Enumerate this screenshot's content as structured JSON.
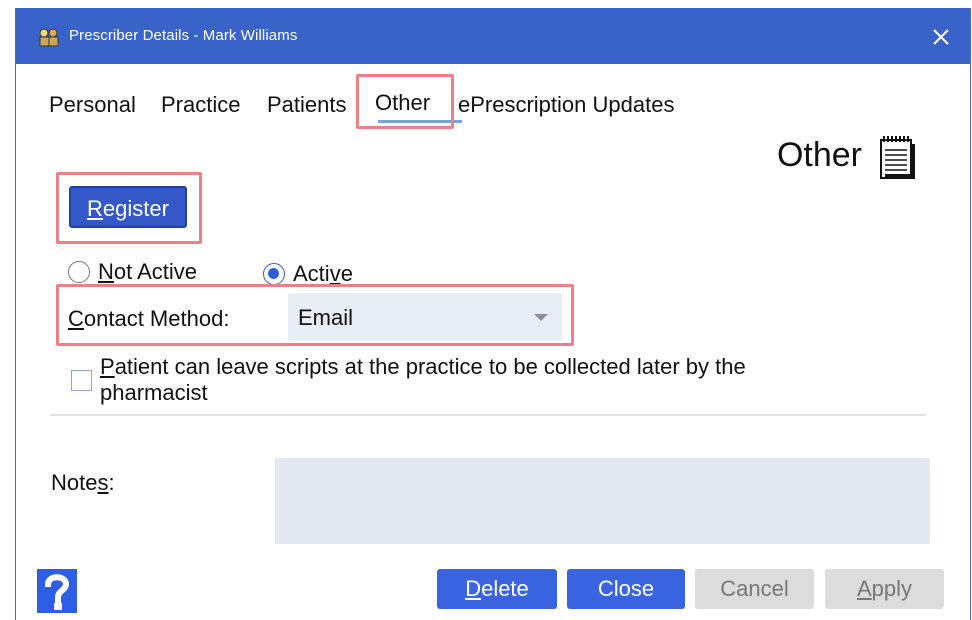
{
  "window": {
    "title": "Prescriber Details - Mark Williams"
  },
  "tabs": [
    {
      "label": "Personal"
    },
    {
      "label": "Practice"
    },
    {
      "label": "Patients"
    },
    {
      "label": "Other",
      "active": true
    },
    {
      "label": "ePrescription Updates"
    }
  ],
  "section": {
    "title": "Other",
    "icon": "notepad-icon"
  },
  "register": {
    "label_accel": "R",
    "label_rest": "egister"
  },
  "status": {
    "options": [
      {
        "accel": "N",
        "rest": "ot Active",
        "selected": false
      },
      {
        "pre": "Acti",
        "accel": "v",
        "rest": "e",
        "selected": true
      }
    ]
  },
  "contact": {
    "label_accel": "C",
    "label_rest": "ontact Method:",
    "value": "Email"
  },
  "collect": {
    "label_accel": "P",
    "label_rest": "atient can leave scripts at the practice to be collected later by the pharmacist",
    "checked": false
  },
  "notes": {
    "label_pre": "Note",
    "label_accel": "s",
    "label_rest": ":",
    "value": ""
  },
  "footer": {
    "help_icon": "help-icon",
    "delete_accel": "D",
    "delete_rest": "elete",
    "close_label": "Close",
    "cancel_label": "Cancel",
    "apply_accel": "A",
    "apply_rest": "pply"
  },
  "colors": {
    "titlebar": "#3a63c9",
    "primary_button": "#3a63e0",
    "highlight": "#ee7f86",
    "input_bg": "#e9edf5"
  }
}
